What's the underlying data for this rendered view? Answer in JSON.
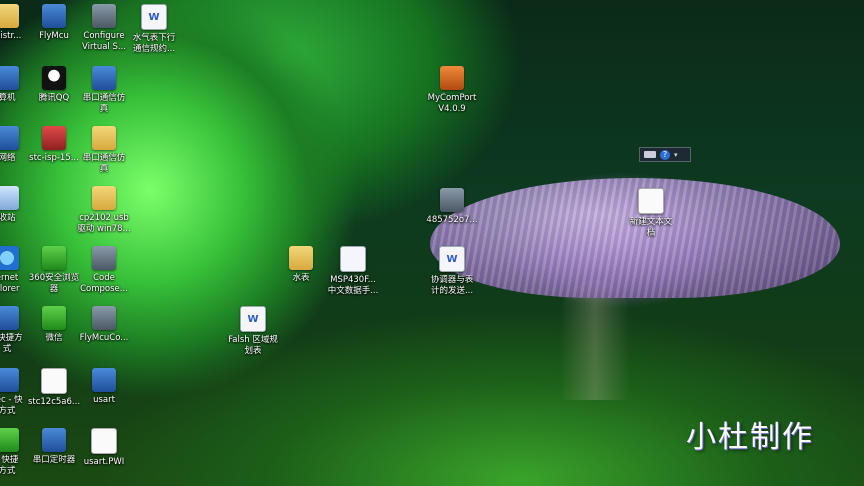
{
  "desktop": {
    "icons": [
      {
        "id": "administrator",
        "label": "inistr...",
        "kind": "folder"
      },
      {
        "id": "flymcu",
        "label": "FlyMcu",
        "kind": "app-blue"
      },
      {
        "id": "configure-virtual",
        "label": "Configure\nVirtual S...",
        "kind": "app-gray"
      },
      {
        "id": "water-meter-doc",
        "label": "水气表下行\n通信规约...",
        "kind": "doc"
      },
      {
        "id": "computer",
        "label": "算机",
        "kind": "app-blue"
      },
      {
        "id": "qq",
        "label": "腾讯QQ",
        "kind": "penguin"
      },
      {
        "id": "serial-sim-1",
        "label": "串口通信仿\n真",
        "kind": "app-blue"
      },
      {
        "id": "mycomport",
        "label": "MyComPort\nV4.0.9",
        "kind": "app-orange"
      },
      {
        "id": "network",
        "label": "网络",
        "kind": "app-blue"
      },
      {
        "id": "stc-isp",
        "label": "stc-isp-15...",
        "kind": "app-red"
      },
      {
        "id": "serial-sim-2",
        "label": "串口通信仿\n真",
        "kind": "folder"
      },
      {
        "id": "recycle",
        "label": "收站",
        "kind": "recycle"
      },
      {
        "id": "cp2102",
        "label": "cp2102 usb\n驱动 win78...",
        "kind": "folder"
      },
      {
        "id": "file-4857",
        "label": "485752o7...",
        "kind": "app-gray"
      },
      {
        "id": "new-text",
        "label": "新建文本文\n档",
        "kind": "txt"
      },
      {
        "id": "ie",
        "label": "ernet\nplorer",
        "kind": "ie"
      },
      {
        "id": "360",
        "label": "360安全浏览\n器",
        "kind": "app-green"
      },
      {
        "id": "code-composer",
        "label": "Code\nCompose...",
        "kind": "app-gray"
      },
      {
        "id": "water-meter-folder",
        "label": "水表",
        "kind": "folder"
      },
      {
        "id": "msp430",
        "label": "MSP430F...\n中文数据手...",
        "kind": "doc"
      },
      {
        "id": "coordinator",
        "label": "协调器与表\n计的发送...",
        "kind": "doc"
      },
      {
        "id": "shortcut-1",
        "label": "- 快捷方\n式",
        "kind": "app-blue"
      },
      {
        "id": "wechat",
        "label": "微信",
        "kind": "app-green"
      },
      {
        "id": "flymcuco",
        "label": "FlyMcuCo...",
        "kind": "app-gray"
      },
      {
        "id": "falsh",
        "label": "Falsh 区域规\n划表",
        "kind": "doc"
      },
      {
        "id": "sec-shortcut",
        "label": "sec - 快\n方式",
        "kind": "app-blue"
      },
      {
        "id": "stc12c5a6",
        "label": "stc12c5a6...",
        "kind": "txt"
      },
      {
        "id": "usart",
        "label": "usart",
        "kind": "app-blue"
      },
      {
        "id": "v-shortcut",
        "label": "- 快捷\n方式",
        "kind": "app-green"
      },
      {
        "id": "serial-timer",
        "label": "串口定时器",
        "kind": "app-blue"
      },
      {
        "id": "usart-pwi",
        "label": "usart.PWI",
        "kind": "txt"
      }
    ]
  },
  "tray": {
    "help_glyph": "?",
    "arrow_glyph": "▾"
  },
  "watermark": {
    "text": "小杜制作"
  }
}
